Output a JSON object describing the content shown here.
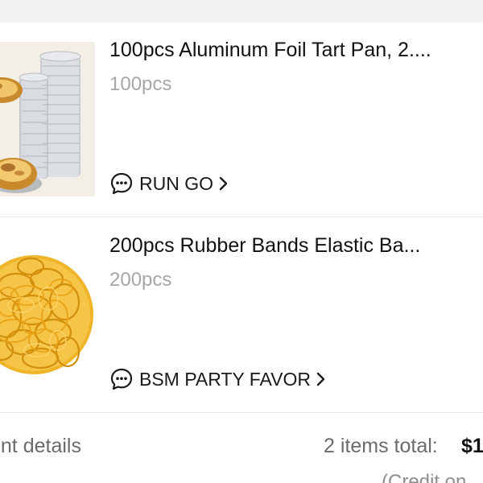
{
  "items": [
    {
      "title": "100pcs Aluminum Foil Tart Pan, 2....",
      "variant": "100pcs",
      "store": "RUN GO",
      "image": "aluminum-tart-pans-image"
    },
    {
      "title": "200pcs Rubber Bands Elastic Ba...",
      "variant": "200pcs",
      "store": "BSM PARTY FAVOR",
      "image": "rubber-bands-image"
    }
  ],
  "footer": {
    "payment_details": "ent details",
    "items_total_label": "2 items total:",
    "total_amount": "$1",
    "credit_note": "(Credit on"
  },
  "icons": {
    "store": "chat-bubble-icon",
    "chevron": "chevron-right-icon"
  },
  "colors": {
    "title": "#111111",
    "variant": "#a7a7ab",
    "divider": "#e6e6e8",
    "top_strip": "#f2f2f4"
  }
}
